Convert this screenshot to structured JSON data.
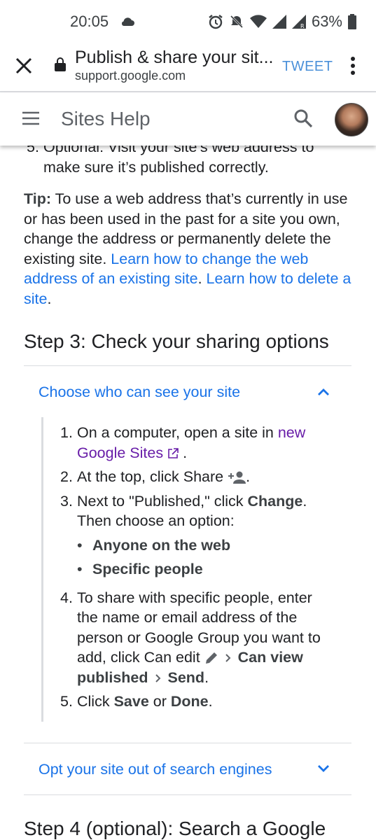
{
  "status": {
    "time": "20:05",
    "battery": "63%"
  },
  "browser": {
    "title": "Publish & share your sit...",
    "url": "support.google.com",
    "tweet_label": "TWEET"
  },
  "site": {
    "title": "Sites Help"
  },
  "content": {
    "step5_num": "5.",
    "step5_text": "Optional: Visit your site’s web address to make sure it’s published correctly.",
    "tip_label": "Tip:",
    "tip_text": " To use a web address that’s currently in use or has been used in the past for a site you own, change the address or permanently delete the existing site. ",
    "tip_link1": "Learn how to change the web address of an existing site",
    "tip_sep": ". ",
    "tip_link2": "Learn how to delete a site",
    "tip_end": ".",
    "step3_heading": "Step 3: Check your sharing options",
    "acc1_title": "Choose who can see your site",
    "acc2_title": "Opt your site out of search engines",
    "step4_heading": "Step 4 (optional): Search a Google",
    "steps": {
      "s1_num": "1.",
      "s1_text": "On a computer, open a site in ",
      "s1_link": "new Google Sites",
      "s1_end": " .",
      "s2_num": "2.",
      "s2_text": "At the top, click Share",
      "s2_end": ".",
      "s3_num": "3.",
      "s3_text_a": "Next to \"Published,\" click ",
      "s3_bold": "Change",
      "s3_text_b": ". Then choose an option:",
      "s3_opt1": "Anyone on the web",
      "s3_opt2": "Specific people",
      "s4_num": "4.",
      "s4_text": "To share with specific people, enter the name or email address of the person or Google Group you want to add, click Can edit",
      "s4_bold1": "Can view published",
      "s4_bold2": "Send",
      "s4_end": ".",
      "s5_num": "5.",
      "s5_text_a": "Click ",
      "s5_bold1": "Save",
      "s5_text_b": " or ",
      "s5_bold2": "Done",
      "s5_end": "."
    }
  }
}
